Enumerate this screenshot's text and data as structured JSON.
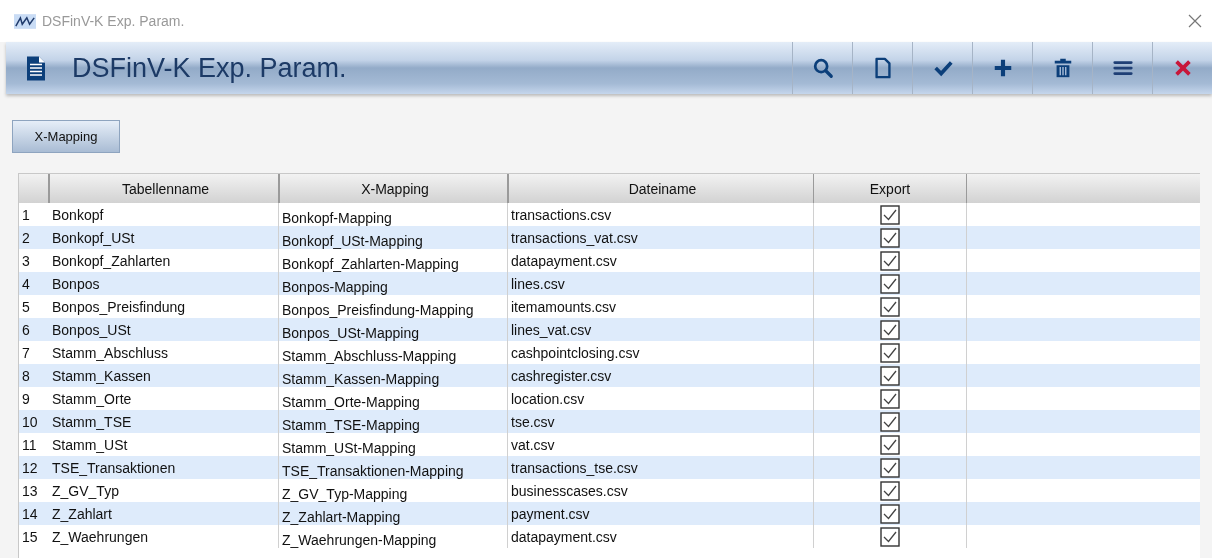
{
  "window": {
    "title": "DSFinV-K Exp. Param."
  },
  "header": {
    "title": "DSFinV-K Exp. Param.",
    "tools": [
      {
        "kind": "search"
      },
      {
        "kind": "new"
      },
      {
        "kind": "confirm"
      },
      {
        "kind": "add"
      },
      {
        "kind": "delete"
      },
      {
        "kind": "menu"
      },
      {
        "kind": "cancel"
      }
    ]
  },
  "mapping_button": "X-Mapping",
  "table": {
    "columns": [
      "Tabellenname",
      "X-Mapping",
      "Dateiname",
      "Export"
    ],
    "rows": [
      {
        "index": "1",
        "table": "Bonkopf",
        "mapping": "Bonkopf-Mapping",
        "file": "transactions.csv",
        "export": true
      },
      {
        "index": "2",
        "table": "Bonkopf_USt",
        "mapping": "Bonkopf_USt-Mapping",
        "file": "transactions_vat.csv",
        "export": true
      },
      {
        "index": "3",
        "table": "Bonkopf_Zahlarten",
        "mapping": "Bonkopf_Zahlarten-Mapping",
        "file": "datapayment.csv",
        "export": true
      },
      {
        "index": "4",
        "table": "Bonpos",
        "mapping": "Bonpos-Mapping",
        "file": "lines.csv",
        "export": true
      },
      {
        "index": "5",
        "table": "Bonpos_Preisfindung",
        "mapping": "Bonpos_Preisfindung-Mapping",
        "file": "itemamounts.csv",
        "export": true
      },
      {
        "index": "6",
        "table": "Bonpos_USt",
        "mapping": "Bonpos_USt-Mapping",
        "file": "lines_vat.csv",
        "export": true
      },
      {
        "index": "7",
        "table": "Stamm_Abschluss",
        "mapping": "Stamm_Abschluss-Mapping",
        "file": "cashpointclosing.csv",
        "export": true
      },
      {
        "index": "8",
        "table": "Stamm_Kassen",
        "mapping": "Stamm_Kassen-Mapping",
        "file": "cashregister.csv",
        "export": true
      },
      {
        "index": "9",
        "table": "Stamm_Orte",
        "mapping": "Stamm_Orte-Mapping",
        "file": "location.csv",
        "export": true
      },
      {
        "index": "10",
        "table": "Stamm_TSE",
        "mapping": "Stamm_TSE-Mapping",
        "file": "tse.csv",
        "export": true
      },
      {
        "index": "11",
        "table": "Stamm_USt",
        "mapping": "Stamm_USt-Mapping",
        "file": "vat.csv",
        "export": true
      },
      {
        "index": "12",
        "table": "TSE_Transaktionen",
        "mapping": "TSE_Transaktionen-Mapping",
        "file": "transactions_tse.csv",
        "export": true
      },
      {
        "index": "13",
        "table": "Z_GV_Typ",
        "mapping": "Z_GV_Typ-Mapping",
        "file": "businesscases.csv",
        "export": true
      },
      {
        "index": "14",
        "table": "Z_Zahlart",
        "mapping": "Z_Zahlart-Mapping",
        "file": "payment.csv",
        "export": true
      },
      {
        "index": "15",
        "table": "Z_Waehrungen",
        "mapping": "Z_Waehrungen-Mapping",
        "file": "datapayment.csv",
        "export": true
      }
    ]
  }
}
